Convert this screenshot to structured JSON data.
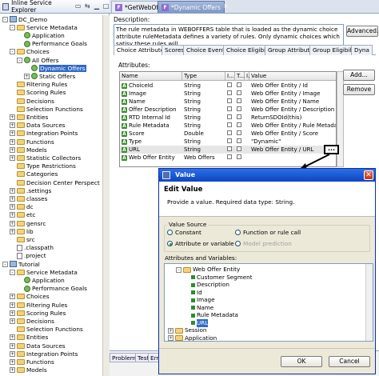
{
  "explorer": {
    "title": "Inline Service Explorer",
    "tree": [
      {
        "label": "DC_Demo",
        "depth": 0,
        "kind": "project",
        "exp": "-"
      },
      {
        "label": "Service Metadata",
        "depth": 1,
        "kind": "folder",
        "exp": "-"
      },
      {
        "label": "Application",
        "depth": 2,
        "kind": "entity",
        "exp": ""
      },
      {
        "label": "Performance Goals",
        "depth": 2,
        "kind": "entity",
        "exp": ""
      },
      {
        "label": "Choices",
        "depth": 1,
        "kind": "folder",
        "exp": "-"
      },
      {
        "label": "All Offers",
        "depth": 2,
        "kind": "entity",
        "exp": "-"
      },
      {
        "label": "Dynamic Offers",
        "depth": 3,
        "kind": "entity",
        "exp": "",
        "selected": true
      },
      {
        "label": "Static Offers",
        "depth": 3,
        "kind": "entity",
        "exp": "+"
      },
      {
        "label": "Filtering Rules",
        "depth": 1,
        "kind": "folder",
        "exp": ""
      },
      {
        "label": "Scoring Rules",
        "depth": 1,
        "kind": "folder",
        "exp": ""
      },
      {
        "label": "Decisions",
        "depth": 1,
        "kind": "folder",
        "exp": ""
      },
      {
        "label": "Selection Functions",
        "depth": 1,
        "kind": "folder",
        "exp": ""
      },
      {
        "label": "Entities",
        "depth": 1,
        "kind": "folder",
        "exp": "+"
      },
      {
        "label": "Data Sources",
        "depth": 1,
        "kind": "folder",
        "exp": "+"
      },
      {
        "label": "Integration Points",
        "depth": 1,
        "kind": "folder",
        "exp": "+"
      },
      {
        "label": "Functions",
        "depth": 1,
        "kind": "folder",
        "exp": "+"
      },
      {
        "label": "Models",
        "depth": 1,
        "kind": "folder",
        "exp": "+"
      },
      {
        "label": "Statistic Collectors",
        "depth": 1,
        "kind": "folder",
        "exp": "+"
      },
      {
        "label": "Type Restrictions",
        "depth": 1,
        "kind": "folder",
        "exp": ""
      },
      {
        "label": "Categories",
        "depth": 1,
        "kind": "folder",
        "exp": ""
      },
      {
        "label": "Decision Center Perspect",
        "depth": 1,
        "kind": "folder",
        "exp": ""
      },
      {
        "label": ".settings",
        "depth": 0,
        "kind": "folder",
        "exp": "+",
        "indent": 1
      },
      {
        "label": "classes",
        "depth": 0,
        "kind": "folder",
        "exp": "+",
        "indent": 1
      },
      {
        "label": "dc",
        "depth": 0,
        "kind": "folder",
        "exp": "+",
        "indent": 1
      },
      {
        "label": "etc",
        "depth": 0,
        "kind": "folder",
        "exp": "+",
        "indent": 1
      },
      {
        "label": "gensrc",
        "depth": 0,
        "kind": "folder",
        "exp": "+",
        "indent": 1
      },
      {
        "label": "lib",
        "depth": 0,
        "kind": "folder",
        "exp": "+",
        "indent": 1
      },
      {
        "label": "src",
        "depth": 0,
        "kind": "folder",
        "exp": "",
        "indent": 1
      },
      {
        "label": ".classpath",
        "depth": 0,
        "kind": "file",
        "exp": "",
        "indent": 1
      },
      {
        "label": ".project",
        "depth": 0,
        "kind": "file",
        "exp": "",
        "indent": 1
      },
      {
        "label": "Tutorial",
        "depth": 0,
        "kind": "project",
        "exp": "-"
      },
      {
        "label": "Service Metadata",
        "depth": 1,
        "kind": "folder",
        "exp": "-"
      },
      {
        "label": "Application",
        "depth": 2,
        "kind": "entity",
        "exp": ""
      },
      {
        "label": "Performance Goals",
        "depth": 2,
        "kind": "entity",
        "exp": ""
      },
      {
        "label": "Choices",
        "depth": 1,
        "kind": "folder",
        "exp": "+"
      },
      {
        "label": "Filtering Rules",
        "depth": 1,
        "kind": "folder",
        "exp": "+"
      },
      {
        "label": "Scoring Rules",
        "depth": 1,
        "kind": "folder",
        "exp": "+"
      },
      {
        "label": "Decisions",
        "depth": 1,
        "kind": "folder",
        "exp": "+"
      },
      {
        "label": "Selection Functions",
        "depth": 1,
        "kind": "folder",
        "exp": ""
      },
      {
        "label": "Entities",
        "depth": 1,
        "kind": "folder",
        "exp": "+"
      },
      {
        "label": "Data Sources",
        "depth": 1,
        "kind": "folder",
        "exp": "+"
      },
      {
        "label": "Integration Points",
        "depth": 1,
        "kind": "folder",
        "exp": "+"
      },
      {
        "label": "Functions",
        "depth": 1,
        "kind": "folder",
        "exp": "+"
      },
      {
        "label": "Models",
        "depth": 1,
        "kind": "folder",
        "exp": "+"
      }
    ]
  },
  "editor_tabs": [
    {
      "label": "*GetWebOffers",
      "active": false
    },
    {
      "label": "*Dynamic Offers",
      "active": true
    }
  ],
  "editor": {
    "description_label": "Description:",
    "description_text": "The rule metadata in WEBOFFERS table that is loaded as the dynamic choice attribute ruleMetadata defines a variety of rules. Only dynamic choices which satisy these rules will",
    "advanced_button": "Advanced...",
    "subtabs": [
      "Choice Attributes",
      "Scores",
      "Choice Events",
      "Choice Eligibility",
      "Group Attributes",
      "Group Eligibility",
      "Dyna"
    ],
    "attributes_label": "Attributes:",
    "add_button": "Add...",
    "remove_button": "Remove",
    "columns": [
      "Name",
      "Type",
      "I...",
      "T...",
      "I...",
      "Value"
    ],
    "rows": [
      {
        "name": "ChoiceId",
        "type": "String",
        "value": "Web Offer Entity / Id"
      },
      {
        "name": "Image",
        "type": "String",
        "value": "Web Offer Entity / Image"
      },
      {
        "name": "Name",
        "type": "String",
        "value": "Web Offer Entity / Name"
      },
      {
        "name": "Offer Description",
        "type": "String",
        "value": "Web Offer Entity / Description"
      },
      {
        "name": "RTD Internal Id",
        "type": "String",
        "value": "ReturnSDOId(this)"
      },
      {
        "name": "Rule Metadata",
        "type": "String",
        "value": "Web Offer Entity / Rule Metadata"
      },
      {
        "name": "Score",
        "type": "Double",
        "value": "Web Offer Entity / Score"
      },
      {
        "name": "Type",
        "type": "String",
        "value": "\"Dynamic\""
      },
      {
        "name": "URL",
        "type": "String",
        "value": "Web Offer Entity / URL",
        "selected": true
      },
      {
        "name": "Web Offer Entity",
        "type": "Web Offers",
        "value": ""
      }
    ],
    "ellipsis_button": "...",
    "bottom_tabs": [
      "Problems",
      "Test",
      "Erro"
    ]
  },
  "dialog": {
    "title": "Value",
    "heading": "Edit Value",
    "subtitle": "Provide a value. Required data type: String.",
    "value_source_label": "Value Source",
    "options": [
      {
        "label": "Constant",
        "checked": false,
        "enabled": true
      },
      {
        "label": "Function or rule call",
        "checked": false,
        "enabled": true
      },
      {
        "label": "Attribute or variable",
        "checked": true,
        "enabled": true
      },
      {
        "label": "Model prediction",
        "checked": false,
        "enabled": false
      }
    ],
    "vars_label": "Attributes and Variables:",
    "vars_tree": [
      {
        "label": "Web Offer Entity",
        "depth": 1,
        "kind": "folder",
        "exp": "-"
      },
      {
        "label": "Customer Segment",
        "depth": 2,
        "kind": "attr",
        "exp": ""
      },
      {
        "label": "Description",
        "depth": 2,
        "kind": "attr",
        "exp": ""
      },
      {
        "label": "Id",
        "depth": 2,
        "kind": "attr",
        "exp": ""
      },
      {
        "label": "Image",
        "depth": 2,
        "kind": "attr",
        "exp": ""
      },
      {
        "label": "Name",
        "depth": 2,
        "kind": "attr",
        "exp": ""
      },
      {
        "label": "Rule Metadata",
        "depth": 2,
        "kind": "attr",
        "exp": ""
      },
      {
        "label": "URL",
        "depth": 2,
        "kind": "attr",
        "exp": "",
        "selected": true
      },
      {
        "label": "Session",
        "depth": 0,
        "kind": "folder",
        "exp": "+"
      },
      {
        "label": "Application",
        "depth": 0,
        "kind": "folder",
        "exp": "+"
      }
    ],
    "ok_button": "OK",
    "cancel_button": "Cancel"
  }
}
